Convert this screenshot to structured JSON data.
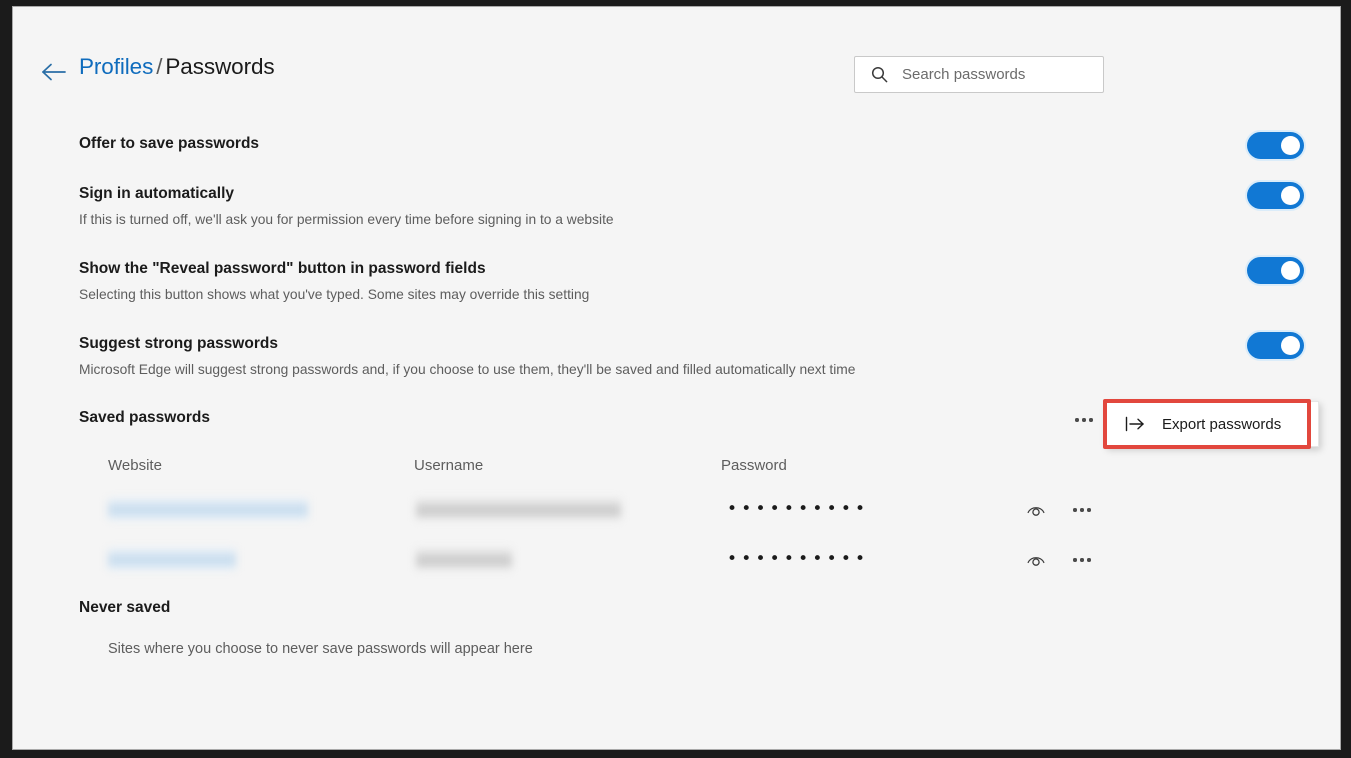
{
  "window": {
    "background_color": "#f5f5f5",
    "frame_color": "#1b1b1b"
  },
  "header": {
    "back_icon": "back-arrow-icon",
    "breadcrumb": {
      "parent": "Profiles",
      "separator": "/",
      "current": "Passwords"
    },
    "accent_color": "#0f6cbd"
  },
  "search": {
    "icon": "search-icon",
    "placeholder": "Search passwords",
    "value": ""
  },
  "settings": [
    {
      "title": "Offer to save passwords",
      "description": "",
      "toggle_state": "on"
    },
    {
      "title": "Sign in automatically",
      "description": "If this is turned off, we'll ask you for permission every time before signing in to a website",
      "toggle_state": "on"
    },
    {
      "title": "Show the \"Reveal password\" button in password fields",
      "description": "Selecting this button shows what you've typed. Some sites may override this setting",
      "toggle_state": "on"
    },
    {
      "title": "Suggest strong passwords",
      "description": "Microsoft Edge will suggest strong passwords and, if you choose to use them, they'll be saved and filled automatically next time",
      "toggle_state": "on"
    }
  ],
  "saved_passwords": {
    "heading": "Saved passwords",
    "more_icon": "more-horizontal-icon",
    "columns": [
      "Website",
      "Username",
      "Password"
    ],
    "rows": [
      {
        "website": "",
        "website_redacted": true,
        "website_blur_width": 200,
        "username": "",
        "username_redacted": true,
        "username_blur_width": 205,
        "password_mask": "••••••••••",
        "reveal_icon": "eye-icon",
        "more_icon": "more-horizontal-icon"
      },
      {
        "website": "",
        "website_redacted": true,
        "website_blur_width": 128,
        "username": "",
        "username_redacted": true,
        "username_blur_width": 96,
        "password_mask": "••••••••••",
        "reveal_icon": "eye-icon",
        "more_icon": "more-horizontal-icon"
      }
    ]
  },
  "never_saved": {
    "heading": "Never saved",
    "empty_text": "Sites where you choose to never save passwords will appear here"
  },
  "export_menu": {
    "icon": "export-icon",
    "label": "Export passwords",
    "highlight_color": "#e2473d"
  },
  "colors": {
    "toggle_on": "#1178d4",
    "link": "#0f6cbd",
    "text_primary": "#1b1b1b",
    "text_secondary": "#5d5d5d"
  }
}
